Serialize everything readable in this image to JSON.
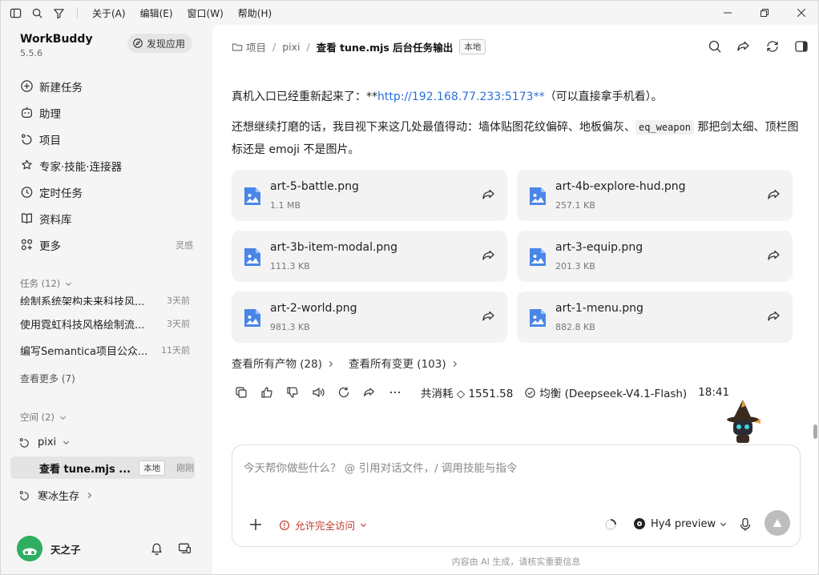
{
  "menu": {
    "about": "关于(A)",
    "edit": "编辑(E)",
    "window": "窗口(W)",
    "help": "帮助(H)"
  },
  "app": {
    "name": "WorkBuddy",
    "version": "5.5.6",
    "discover_label": "发现应用"
  },
  "nav": {
    "items": [
      {
        "label": "新建任务",
        "icon": "new-task-icon"
      },
      {
        "label": "助理",
        "icon": "assistant-icon"
      },
      {
        "label": "项目",
        "icon": "project-icon"
      },
      {
        "label": "专家·技能·连接器",
        "icon": "expert-icon"
      },
      {
        "label": "定时任务",
        "icon": "clock-icon"
      },
      {
        "label": "资料库",
        "icon": "book-icon"
      },
      {
        "label": "更多",
        "icon": "more-icon",
        "extra": "灵感"
      }
    ]
  },
  "tasks": {
    "header": "任务 (12)",
    "items": [
      {
        "title": "绘制系统架构未来科技风...",
        "time": "3天前"
      },
      {
        "title": "使用霓虹科技风格绘制流...",
        "time": "3天前"
      },
      {
        "title": "编写Semantica项目公众...",
        "time": "11天前"
      }
    ],
    "see_more": "查看更多 (7)"
  },
  "spaces": {
    "header": "空间 (2)",
    "items": [
      {
        "label": "pixi"
      },
      {
        "label": "寒冰生存"
      }
    ],
    "active_task": {
      "title": "查看 tune.mjs ...",
      "tag": "本地",
      "time": "刚刚"
    }
  },
  "user": {
    "name": "天之子"
  },
  "breadcrumb": {
    "root": "项目",
    "space": "pixi",
    "title": "查看 tune.mjs 后台任务输出",
    "tag": "本地"
  },
  "message": {
    "p1_prefix": "真机入口已经重新起来了：**",
    "p1_link": "http://192.168.77.233:5173**",
    "p1_suffix": "（可以直接拿手机看）。",
    "p2_prefix": "还想继续打磨的话，我目视下来这几处最值得动：墙体贴图花纹偏碎、地板偏灰、",
    "p2_code": "eq_weapon",
    "p2_suffix": " 那把剑太细、顶栏图标还是 emoji 不是图片。"
  },
  "files": [
    {
      "name": "art-5-battle.png",
      "size": "1.1 MB"
    },
    {
      "name": "art-4b-explore-hud.png",
      "size": "257.1 KB"
    },
    {
      "name": "art-3b-item-modal.png",
      "size": "111.3 KB"
    },
    {
      "name": "art-3-equip.png",
      "size": "201.3 KB"
    },
    {
      "name": "art-2-world.png",
      "size": "981.3 KB"
    },
    {
      "name": "art-1-menu.png",
      "size": "882.8 KB"
    }
  ],
  "links": {
    "artifacts": "查看所有产物 (28)",
    "changes": "查看所有变更 (103)"
  },
  "meta": {
    "cost": "共消耗 ◇ 1551.58",
    "mode": "均衡 (Deepseek-V4.1-Flash)",
    "time": "18:41"
  },
  "composer": {
    "placeholder": "今天帮你做些什么？ @ 引用对话文件，/ 调用技能与指令",
    "access": "允许完全访问",
    "model": "Hy4 preview"
  },
  "disclaimer": "内容由 AI 生成，请核实重要信息",
  "colors": {
    "accent_blue": "#2a6fdb",
    "file_icon": "#4a86e8",
    "warning_red": "#c0392b",
    "avatar_green": "#2fae62"
  }
}
